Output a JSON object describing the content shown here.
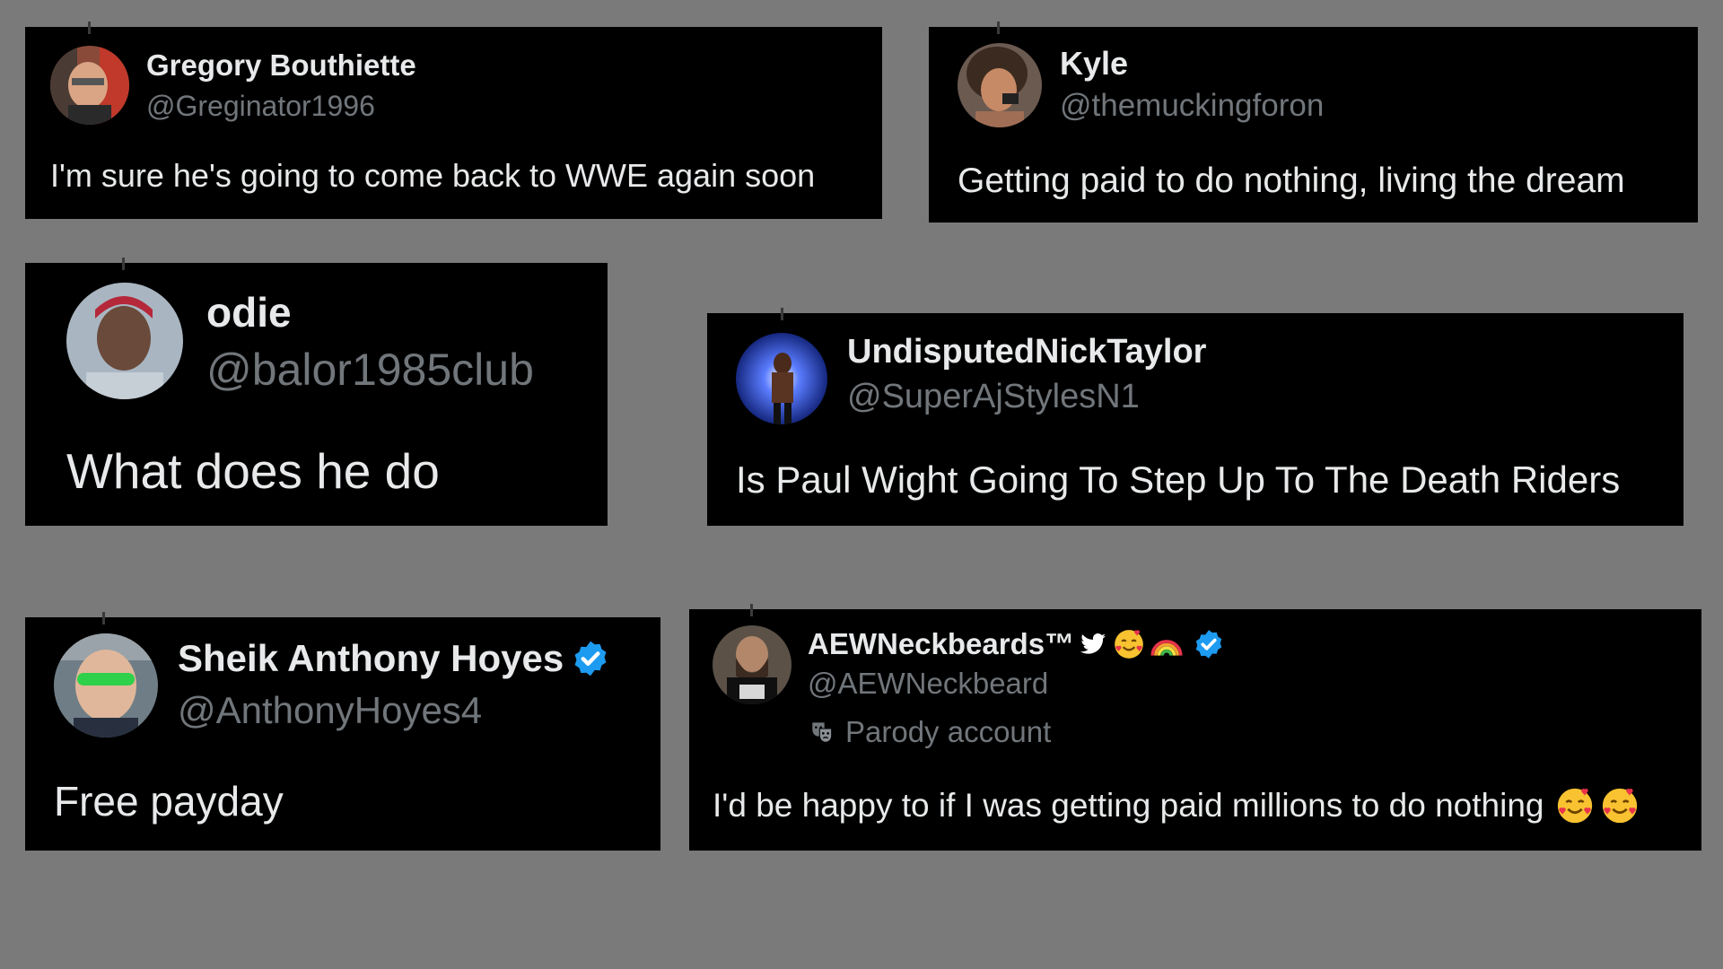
{
  "background_color": "#7a7a7a",
  "card_color": "#000000",
  "text_color": "#e7e9ea",
  "muted_color": "#71767b",
  "verified_color": "#1d9bf0",
  "tweets": [
    {
      "name": "Gregory Bouthiette",
      "handle": "@Greginator1996",
      "text": "I'm sure he's going to come back to WWE again soon",
      "avatar": "avatar-gregory"
    },
    {
      "name": "Kyle",
      "handle": "@themuckingforon",
      "text": "Getting paid to do nothing, living the dream",
      "avatar": "avatar-kyle"
    },
    {
      "name": "odie",
      "handle": "@balor1985club",
      "text": "What does he do",
      "avatar": "avatar-odie"
    },
    {
      "name": "UndisputedNickTaylor",
      "handle": "@SuperAjStylesN1",
      "text": "Is Paul Wight Going To Step Up To The Death Riders",
      "avatar": "avatar-nick"
    },
    {
      "name": "Sheik Anthony Hoyes",
      "handle": "@AnthonyHoyes4",
      "text": "Free payday",
      "avatar": "avatar-sheik",
      "verified": true
    },
    {
      "name": "AEWNeckbeards™",
      "name_icons": [
        "bird-emoji",
        "smiling-face-with-hearts-emoji",
        "rainbow-emoji",
        "verified-badge-icon"
      ],
      "handle": "@AEWNeckbeard",
      "label": "Parody account",
      "label_icon": "theater-mask-icon",
      "text": "I'd be happy to if I was getting paid millions to do nothing",
      "text_icons": [
        "smiling-face-with-hearts-emoji",
        "smiling-face-with-hearts-emoji"
      ],
      "avatar": "avatar-aewneckbeard",
      "verified": true
    }
  ]
}
